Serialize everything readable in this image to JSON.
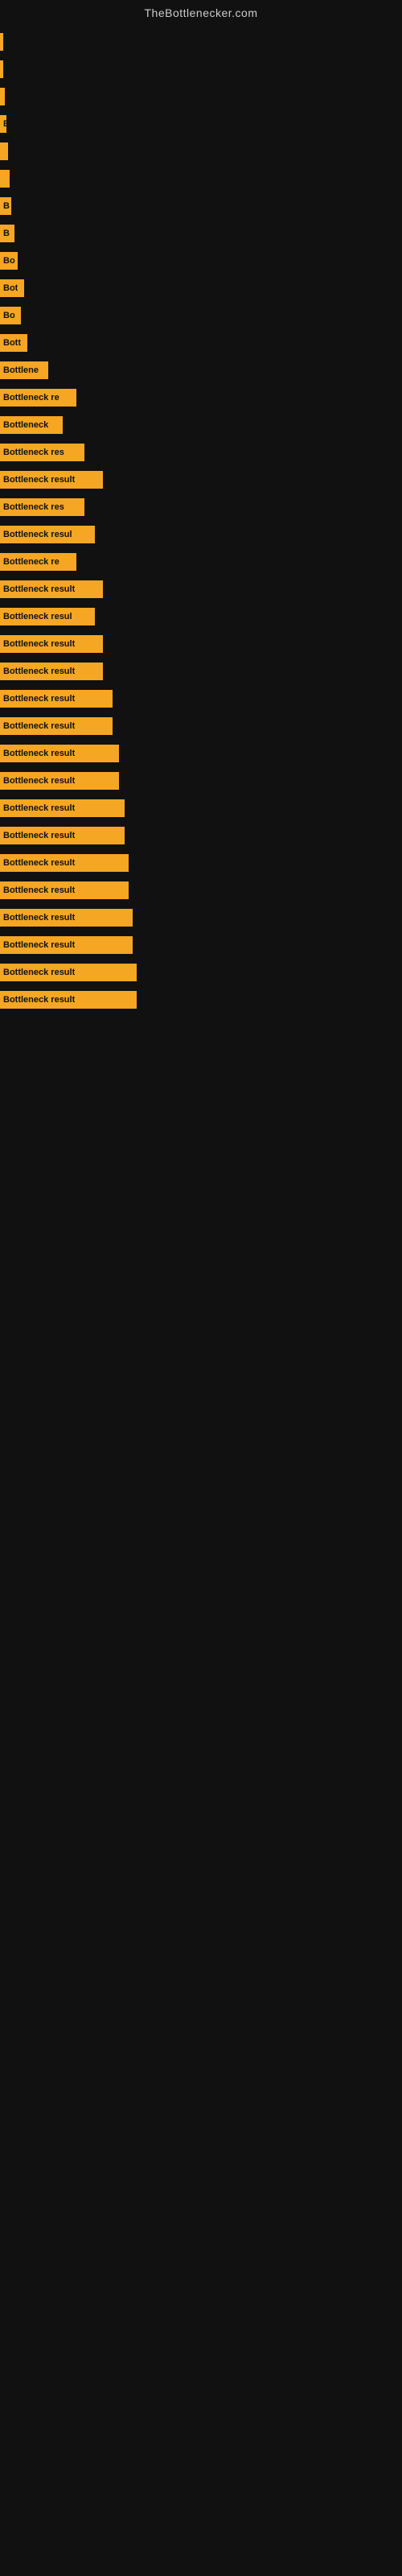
{
  "site": {
    "title": "TheBottlenecker.com"
  },
  "bars": [
    {
      "label": "",
      "width": 2
    },
    {
      "label": "",
      "width": 4
    },
    {
      "label": "",
      "width": 6
    },
    {
      "label": "B",
      "width": 8
    },
    {
      "label": "",
      "width": 10
    },
    {
      "label": "",
      "width": 12
    },
    {
      "label": "B",
      "width": 14
    },
    {
      "label": "B",
      "width": 18
    },
    {
      "label": "Bo",
      "width": 22
    },
    {
      "label": "Bot",
      "width": 30
    },
    {
      "label": "Bo",
      "width": 26
    },
    {
      "label": "Bott",
      "width": 34
    },
    {
      "label": "Bottlene",
      "width": 60
    },
    {
      "label": "Bottleneck re",
      "width": 95
    },
    {
      "label": "Bottleneck",
      "width": 78
    },
    {
      "label": "Bottleneck res",
      "width": 105
    },
    {
      "label": "Bottleneck result",
      "width": 128
    },
    {
      "label": "Bottleneck res",
      "width": 105
    },
    {
      "label": "Bottleneck resul",
      "width": 118
    },
    {
      "label": "Bottleneck re",
      "width": 95
    },
    {
      "label": "Bottleneck result",
      "width": 128
    },
    {
      "label": "Bottleneck resul",
      "width": 118
    },
    {
      "label": "Bottleneck result",
      "width": 128
    },
    {
      "label": "Bottleneck result",
      "width": 128
    },
    {
      "label": "Bottleneck result",
      "width": 140
    },
    {
      "label": "Bottleneck result",
      "width": 140
    },
    {
      "label": "Bottleneck result",
      "width": 148
    },
    {
      "label": "Bottleneck result",
      "width": 148
    },
    {
      "label": "Bottleneck result",
      "width": 155
    },
    {
      "label": "Bottleneck result",
      "width": 155
    },
    {
      "label": "Bottleneck result",
      "width": 160
    },
    {
      "label": "Bottleneck result",
      "width": 160
    },
    {
      "label": "Bottleneck result",
      "width": 165
    },
    {
      "label": "Bottleneck result",
      "width": 165
    },
    {
      "label": "Bottleneck result",
      "width": 170
    },
    {
      "label": "Bottleneck result",
      "width": 170
    }
  ]
}
